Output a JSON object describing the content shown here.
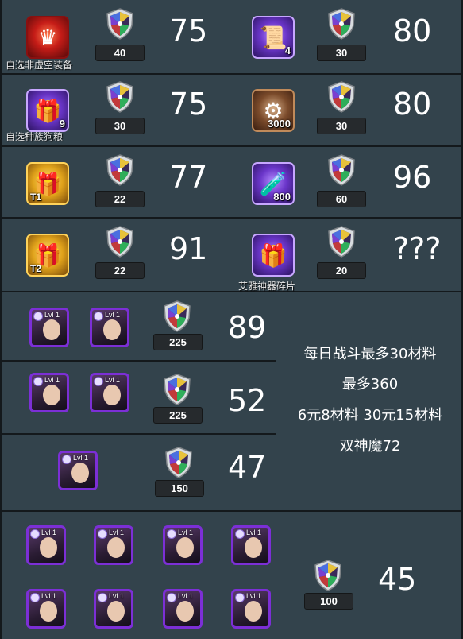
{
  "colors": {
    "background": "#33434c",
    "divider": "#14191c",
    "text": "#ffffff",
    "hero_frame": "#7c2fd6"
  },
  "items": [
    {
      "name": "自选非虚空装备",
      "qty": "",
      "tier": "",
      "style": "red",
      "icon": "crown-icon",
      "cost": "40",
      "score": "75"
    },
    {
      "name": "",
      "qty": "4",
      "tier": "",
      "style": "purple",
      "icon": "scroll-icon",
      "cost": "30",
      "score": "80"
    },
    {
      "name": "自选种族狗粮",
      "qty": "9",
      "tier": "",
      "style": "purple",
      "icon": "treasure-chest-icon",
      "cost": "30",
      "score": "75"
    },
    {
      "name": "",
      "qty": "3000",
      "tier": "",
      "style": "brown",
      "icon": "coin-pile-icon",
      "cost": "30",
      "score": "80"
    },
    {
      "name": "",
      "qty": "",
      "tier": "T1",
      "style": "gold",
      "icon": "gold-chest-icon",
      "cost": "22",
      "score": "77"
    },
    {
      "name": "",
      "qty": "800",
      "tier": "",
      "style": "purple",
      "icon": "potion-icon",
      "cost": "60",
      "score": "96"
    },
    {
      "name": "",
      "qty": "",
      "tier": "T2",
      "style": "gold",
      "icon": "gold-chest-icon",
      "cost": "22",
      "score": "91"
    },
    {
      "name": "艾雅神器碎片",
      "qty": "",
      "tier": "",
      "style": "purple",
      "icon": "artifact-chest-icon",
      "cost": "20",
      "score": "???"
    }
  ],
  "hero_level": "Lvl 1",
  "hero_bundles": [
    {
      "heroes": 2,
      "cost": "225",
      "score": "89"
    },
    {
      "heroes": 2,
      "cost": "225",
      "score": "52"
    },
    {
      "heroes": 1,
      "cost": "150",
      "score": "47"
    },
    {
      "heroes": 8,
      "cost": "100",
      "score": "45"
    }
  ],
  "notes": {
    "line1": "每日战斗最多30材料",
    "line2": "最多360",
    "line3": "6元8材料 30元15材料",
    "line4": "双神魔72"
  }
}
